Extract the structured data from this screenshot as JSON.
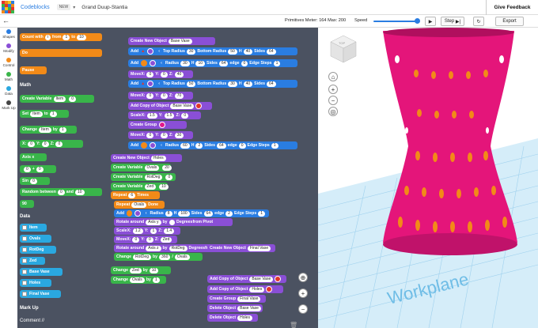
{
  "header": {
    "app_name": "Codeblocks",
    "new_badge": "NEW",
    "project_title": "Grand Duup-Stantia",
    "feedback": "Give Feedback"
  },
  "toolbar": {
    "primitives": "Primitives Meter: 164 Max: 200",
    "speed": "Speed",
    "step": "Step",
    "export": "Export"
  },
  "categories": [
    {
      "label": "Shapes",
      "color": "#2a7de1"
    },
    {
      "label": "Modify",
      "color": "#8a4fd6"
    },
    {
      "label": "Control",
      "color": "#f28a18"
    },
    {
      "label": "Math",
      "color": "#39b54a"
    },
    {
      "label": "Data",
      "color": "#2aa8e0"
    },
    {
      "label": "Mark Up",
      "color": "#444"
    }
  ],
  "flyout": {
    "count_with": "Count with",
    "count_var": "i",
    "count_from": "from",
    "count_from_val": "1",
    "count_to": "to",
    "count_to_val": "10",
    "do": "Do",
    "pause": "Pause",
    "math_title": "Math",
    "create_variable": "Create Variable",
    "create_variable_name": "Item",
    "create_variable_val": "0",
    "set": "Set",
    "set_name": "Item",
    "set_to": "to",
    "set_val": "1",
    "change": "Change",
    "change_name": "Item",
    "change_by": "by",
    "change_val": "1",
    "xyz_x": "X:",
    "xyz_y": "Y:",
    "xyz_z": "Z:",
    "xyz_xval": "0",
    "xyz_yval": "0",
    "xyz_zval": "0",
    "axis": "Axis x",
    "plus_a": "0",
    "plus_op": "+",
    "plus_b": "0",
    "sin": "Sin",
    "sin_val": "0",
    "random": "Random between",
    "random_a": "0",
    "random_and": "and",
    "random_b": "10",
    "ninety": "90",
    "data_title": "Data",
    "data_items": [
      "Item",
      "Ovals",
      "RotDeg",
      "Zed",
      "Base Vase",
      "Holes",
      "Final Vase"
    ],
    "markup_title": "Mark Up",
    "comment": "Comment //"
  },
  "workspace": {
    "create_new_object": "Create New Object",
    "base_vase": "Base Vase",
    "add": "Add",
    "top_radius": "Top Radius",
    "tr1": "30",
    "bottom_radius": "Bottom Radius",
    "br1": "50",
    "h_label": "H",
    "h1": "40",
    "sides": "Sides",
    "s1": "64",
    "radius": "Radius",
    "r2": "30",
    "h2": "10",
    "s2": "64",
    "edge": "edge",
    "e2": "0",
    "edge_steps": "Edge Steps",
    "es2": "1",
    "move": "Move",
    "mx": "0",
    "my": "0",
    "mz": "40",
    "tr3": "50",
    "br3": "30",
    "h3": "40",
    "s3": "64",
    "add_copy": "Add Copy of Object",
    "mz2": "70",
    "scale": "Scale",
    "sx": "1.5",
    "sy": "1.5",
    "sz": "0",
    "create_group": "Create Group",
    "mz3": "30",
    "r4": "60",
    "h4": "2",
    "s4": "64",
    "e4": "0",
    "es4": "1",
    "holes": "Holes",
    "ovals": "Ovals",
    "ovals_val": "20",
    "rotdeg": "RotDeg",
    "rotdeg_val": "0",
    "zed": "Zed",
    "zed_val": "10",
    "repeat": "Repeat",
    "repeat_val": "6",
    "times": "Times",
    "repeat2": "Repeat",
    "done": "Done",
    "r5": "8",
    "h5": "100",
    "s5": "64",
    "e5": "2",
    "es5": "1",
    "rotate_around": "Rotate around",
    "axis_y": "Axis y",
    "by": "by",
    "degrees": "Degrees",
    "from_pivot": "from Pivot",
    "scx": "1.2",
    "scy": "1",
    "scz": "1.4",
    "axis_z": "Axis z",
    "change": "Change",
    "by_val": "360",
    "final_vase": "Final Vase",
    "zed_by": "10",
    "ovals_by": "1"
  },
  "viewport": {
    "workplane": "Workplane",
    "cube_label": "TOP"
  }
}
